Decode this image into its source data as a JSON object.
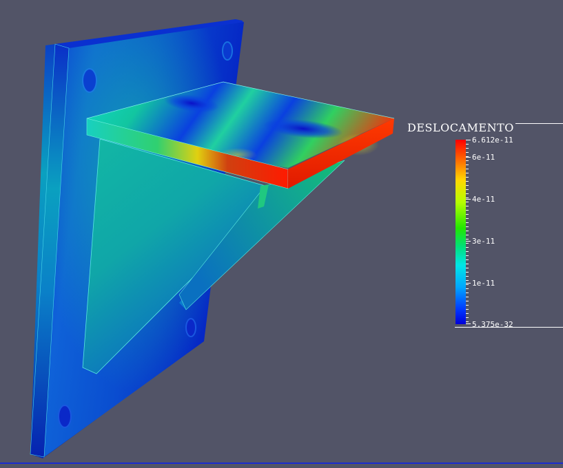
{
  "legend": {
    "title": "DESLOCAMENTO",
    "max_label": "6.612e-11",
    "min_label": "5.375e-32",
    "tick_labels": [
      "6e-11",
      "4e-11",
      "3e-11",
      "1e-11"
    ]
  },
  "colors": {
    "background": "#525467",
    "colormap": [
      "#0000d8",
      "#00a6ff",
      "#00e6e6",
      "#22e600",
      "#b5ff00",
      "#ffd800",
      "#ff6a00",
      "#ff0000"
    ]
  }
}
